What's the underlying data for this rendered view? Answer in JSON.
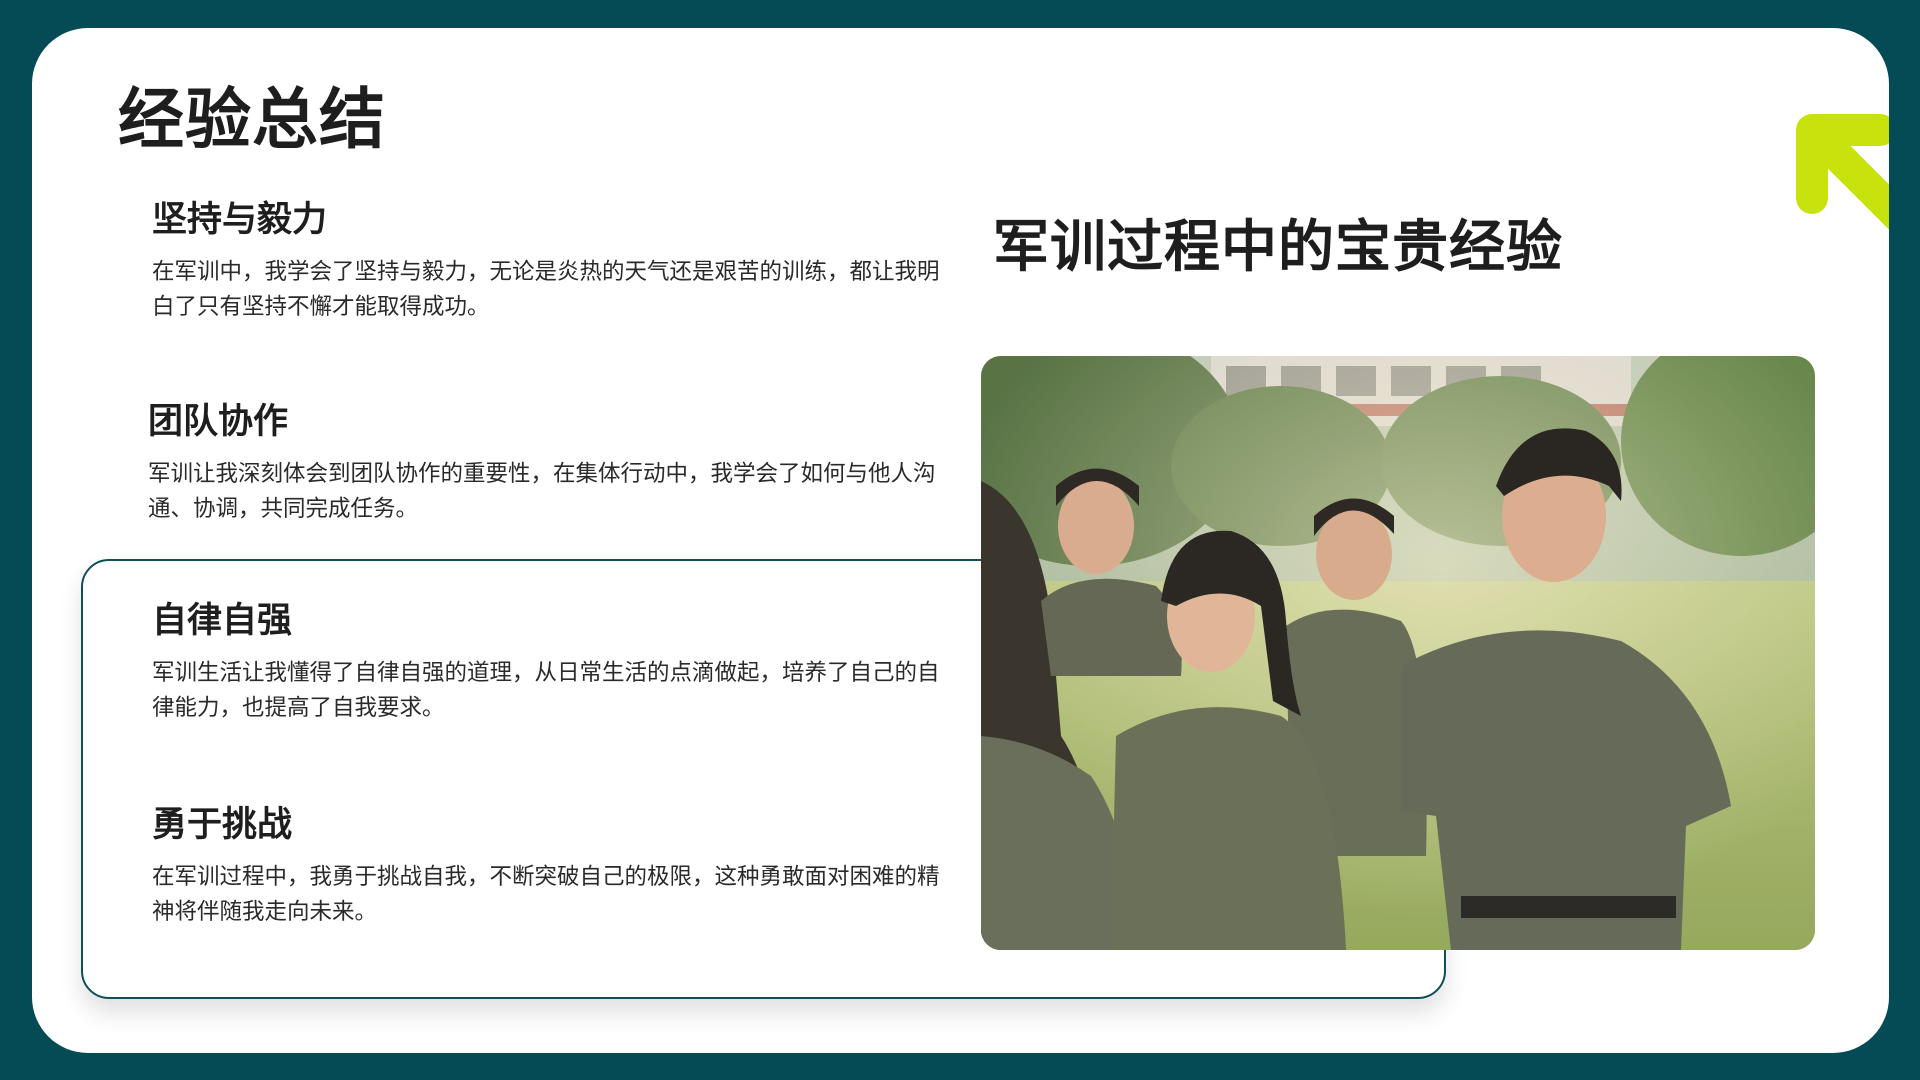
{
  "slide": {
    "title": "经验总结",
    "headline": "军训过程中的宝贵经验",
    "items": [
      {
        "title": "坚持与毅力",
        "desc": "在军训中，我学会了坚持与毅力，无论是炎热的天气还是艰苦的训练，都让我明白了只有坚持不懈才能取得成功。"
      },
      {
        "title": "团队协作",
        "desc": "军训让我深刻体会到团队协作的重要性，在集体行动中，我学会了如何与他人沟通、协调，共同完成任务。"
      },
      {
        "title": "自律自强",
        "desc": "军训生活让我懂得了自律自强的道理，从日常生活的点滴做起，培养了自己的自律能力，也提高了自我要求。"
      },
      {
        "title": "勇于挑战",
        "desc": "在军训过程中，我勇于挑战自我，不断突破自己的极限，这种勇敢面对困难的精神将伴随我走向未来。"
      }
    ],
    "photo_icon": "photo-military-training-students",
    "decor_icon": "arrow-up-left-icon"
  },
  "colors": {
    "frame_background": "#044b55",
    "card_background": "#ffffff",
    "accent_lime": "#c8e20e",
    "section_border": "#0f4e5a",
    "text_dark": "#1e1e1e"
  }
}
